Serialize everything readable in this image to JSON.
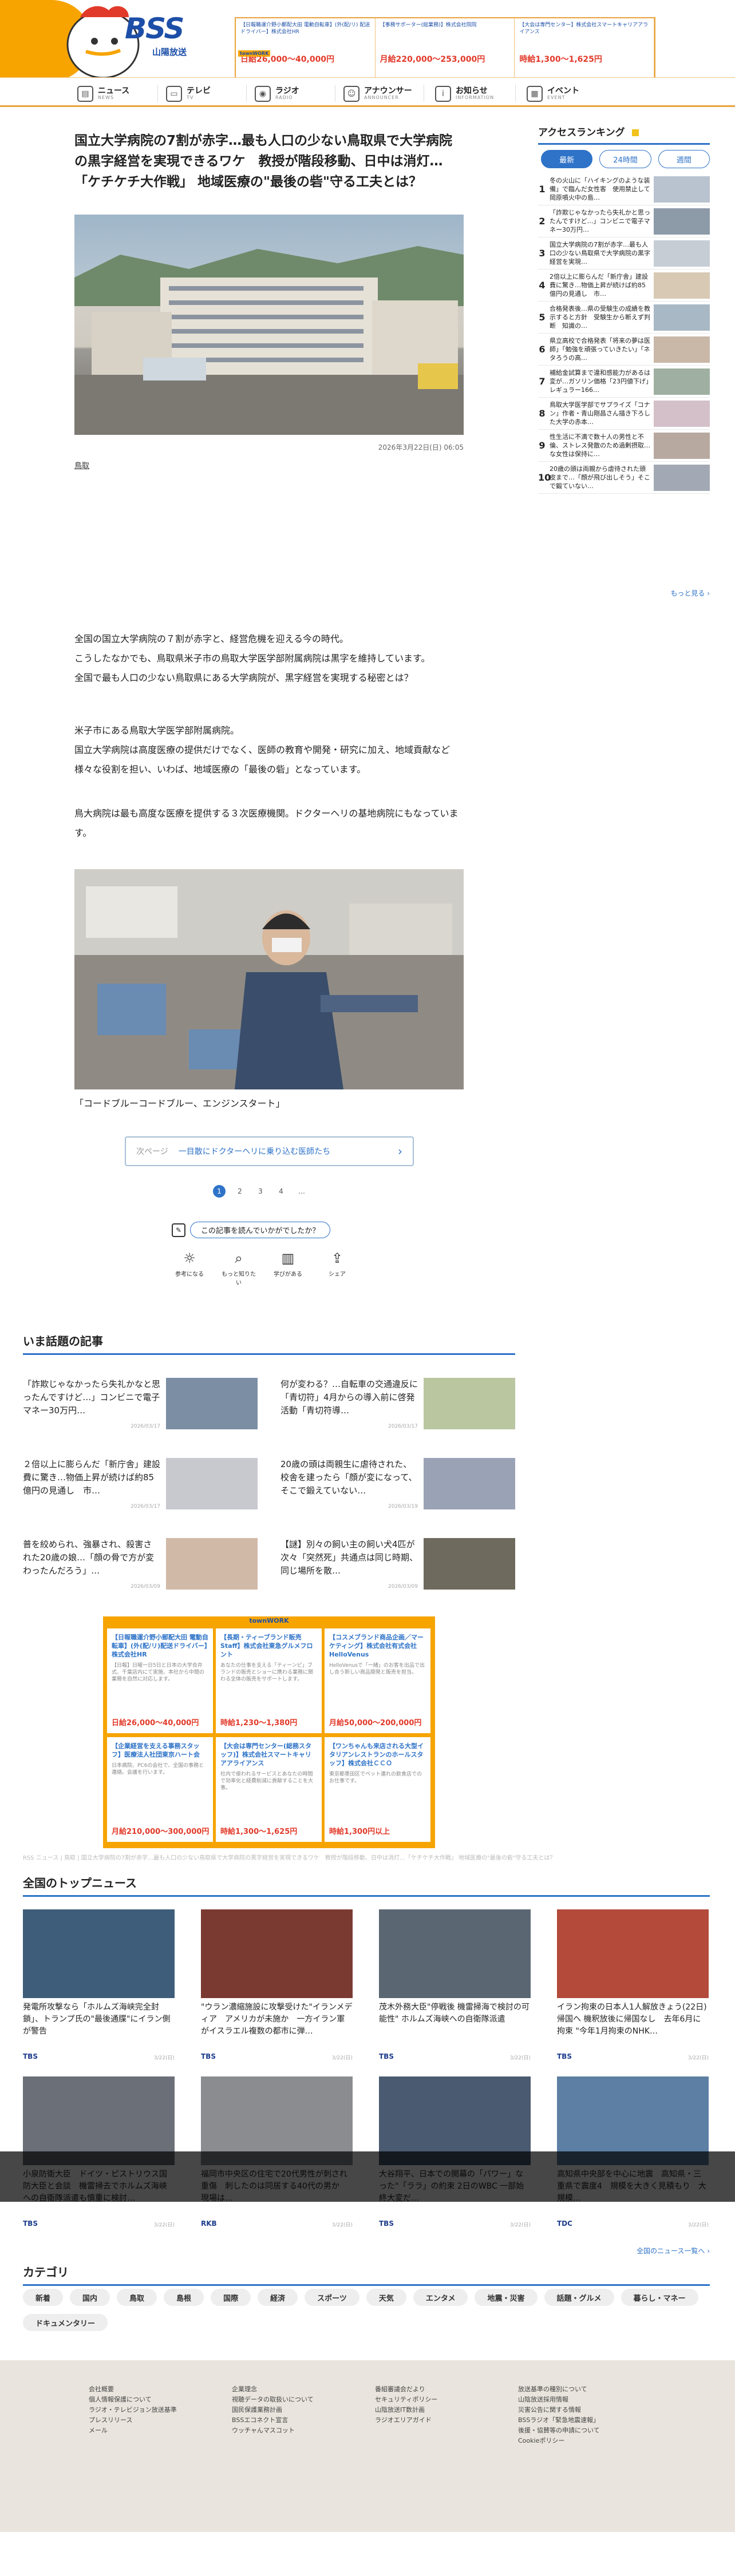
{
  "header": {
    "logo_text": "BSS",
    "logo_sub": "山陽放送",
    "top_ad": {
      "brand": "townWORK",
      "items": [
        {
          "title": "【日報職運介野小郵配大田 電動自転車】(外(配/リ) 配送ドライバー】株式会社HR",
          "salary": "日給26,000〜40,000円"
        },
        {
          "title": "【事務サポーター(総業務)】株式会社院院",
          "salary": "月給220,000〜253,000円"
        },
        {
          "title": "【大会は専門センター】株式会社スマートキャリアアライアンス",
          "salary": "時給1,300〜1,625円"
        }
      ]
    },
    "nav": [
      {
        "label": "ニュース",
        "sub": "NEWS",
        "icon": "news-icon",
        "glyph": "▤"
      },
      {
        "label": "テレビ",
        "sub": "TV",
        "icon": "tv-icon",
        "glyph": "▭"
      },
      {
        "label": "ラジオ",
        "sub": "RADIO",
        "icon": "radio-icon",
        "glyph": "◉"
      },
      {
        "label": "アナウンサー",
        "sub": "ANNOUNCER",
        "icon": "announcer-icon",
        "glyph": "☺"
      },
      {
        "label": "お知らせ",
        "sub": "INFORMATION",
        "icon": "info-icon",
        "glyph": "i"
      },
      {
        "label": "イベント",
        "sub": "EVENT",
        "icon": "event-icon",
        "glyph": "▦"
      }
    ]
  },
  "article": {
    "headline": "国立大学病院の7割が赤字…最も人口の少ない鳥取県で大学病院の黒字経営を実現できるワケ　教授が階段移動、日中は消灯…「ケチケチ大作戦」 地域医療の\"最後の砦\"守る工夫とは？",
    "date": "2026年3月22日(日) 06:05",
    "tag": "鳥取",
    "paragraphs": [
      [
        "全国の国立大学病院の７割が赤字と、経営危機を迎える今の時代。",
        "こうしたなかでも、鳥取県米子市の鳥取大学医学部附属病院は黒字を維持しています。",
        "全国で最も人口の少ない鳥取県にある大学病院が、黒字経営を実現する秘密とは？"
      ],
      [
        "米子市にある鳥取大学医学部附属病院。",
        "国立大学病院は高度医療の提供だけでなく、医師の教育や開発・研究に加え、地域貢献など様々な役割を担い、いわば、地域医療の「最後の砦」となっています。"
      ],
      [
        "鳥大病院は最も高度な医療を提供する３次医療機関。ドクターヘリの基地病院にもなっています。"
      ]
    ],
    "caption": "「コードブルーコードブルー、エンジンスタート」",
    "next_label": "次ページ",
    "next_title": "一目散にドクターヘリに乗り込む医師たち",
    "pages": [
      "1",
      "2",
      "3",
      "4",
      "…"
    ],
    "reaction_question": "この記事を読んでいかがでしたか？",
    "reactions": [
      {
        "label": "参考になる",
        "icon": "bulb-icon",
        "glyph": "☼"
      },
      {
        "label": "もっと知りたい",
        "icon": "magnifier-icon",
        "glyph": "⌕"
      },
      {
        "label": "学びがある",
        "icon": "book-icon",
        "glyph": "▥"
      },
      {
        "label": "シェア",
        "icon": "share-icon",
        "glyph": "⇪"
      }
    ]
  },
  "ranking": {
    "title": "アクセスランキング",
    "tabs": [
      "最新",
      "24時間",
      "週間"
    ],
    "items": [
      {
        "n": "1",
        "text": "冬の火山に「ハイキングのような装備」で臨んだ女性客　使用禁止して岡原噴火中の島…"
      },
      {
        "n": "2",
        "text": "「詐欺じゃなかったら失礼かと思ったんですけど…」コンビニで電子マネー30万円…"
      },
      {
        "n": "3",
        "text": "国立大学病院の7割が赤字…最も人口の少ない鳥取県で大学病院の黒字経営を実現…"
      },
      {
        "n": "4",
        "text": "2倍以上に膨らんだ「新庁舎」建設費に驚き…物価上昇が続けば約85億円の見通し　市…"
      },
      {
        "n": "5",
        "text": "合格発表後…県の受験生の成績を教示すると方針　受験生から断えず判断　知識の…"
      },
      {
        "n": "6",
        "text": "県立高校で合格発表「将来の夢は医師」「勉強を頑張っていきたい」「ネタろうの高…"
      },
      {
        "n": "7",
        "text": "補給金試算まで違和感能力があるは変が…ガソリン価格「23円値下げ」レギュラー166…"
      },
      {
        "n": "8",
        "text": "鳥取大学医学部でサプライズ「コナン」作者・青山剛昌さん描き下ろした大学の赤本…"
      },
      {
        "n": "9",
        "text": "性生活に不満で数十人の男性と不倫、ストレス発散のため過剰摂取…な女性は保持に…"
      },
      {
        "n": "10",
        "text": "20歳の頭は両親から虐待された頭皮まで…「顔が飛び出しそう」そこで鍛ていない…"
      }
    ],
    "more": "もっと見る ›"
  },
  "hot": {
    "title": "いま話題の記事",
    "items": [
      {
        "text": "「詐欺じゃなかったら失礼かなと思ったんですけど…」コンビニで電子マネー30万円…",
        "date": "2026/03/17"
      },
      {
        "text": "何が変わる？…自転車の交通違反に「青切符」4月からの導入前に啓発活動「青切符導…",
        "date": "2026/03/17"
      },
      {
        "text": "２倍以上に膨らんだ「新庁舎」建設費に驚き…物価上昇が続けば約85億円の見通し　市…",
        "date": "2026/03/17"
      },
      {
        "text": "20歳の頭は両親生に虐待された、校舎を建ったら「顔が変になって、そこで鍛えていない…",
        "date": "2026/03/19"
      },
      {
        "text": "普を絞められ、強暴され、殺害された20歳の娘…「顔の骨で方が変わったんだろう」…",
        "date": "2026/03/09"
      },
      {
        "text": "【謎】別々の飼い主の飼い犬4匹が次々「突然死」共通点は同じ時期、同じ場所を散…",
        "date": "2026/03/09"
      }
    ]
  },
  "ad2": {
    "brand": "townWORK",
    "cells": [
      {
        "title": "【日報職運介野小郵配大田 電動自転車】(外(配/リ)配送ドライバー】株式会社HR",
        "body": "【日報】日曜一日5日と日本の大学合弁式、千葉店内にて実施、本社から中間の業務を自然に対応します。",
        "salary": "日給26,000〜40,000円"
      },
      {
        "title": "【長期・ティーブランド販売Staff】株式会社東急グルメフロント",
        "body": "あなたの仕事を支える「ティーンピ」ブランドの販売とショーに携わる業務に関わる全体の販売をサポートします。",
        "salary": "時給1,230〜1,380円"
      },
      {
        "title": "【コスメブランド商品企画／マーケティング】株式会社有式会社HelloVenus",
        "body": "HelloVenusで「一緒」のお客を出品で出し合う新しい商品開発と販売を担当。",
        "salary": "月給50,000〜200,000円"
      },
      {
        "title": "【企業経営を支える事務スタッフ】医療法人社団東京ハート会",
        "body": "日本病院、PC6の会社で、全国の事務と連絡。会議を行います。",
        "salary": "月給210,000〜300,000円"
      },
      {
        "title": "【大会は専門センター(総務スタッフ)】株式会社スマートキャリアアライアンス",
        "body": "社内で使われるサービスとあなたの時間で効率化と経費削減に貢献することを大事。",
        "salary": "時給1,300〜1,625円"
      },
      {
        "title": "【ワンちゃんも来店される大型イタリアンレストランのホールスタッフ】株式会社ＣＣＯ",
        "body": "東京都墨田区でペット連れの飲食店でのお仕事です。",
        "salary": "時給1,300円以上"
      }
    ]
  },
  "breadcrumb": "RSS ニュース | 鳥取 | 国立大学病院の7割が赤字…最も人口の少ない鳥取県で大学病院の黒字経営を実現できるワケ　教授が階段移動、日中は消灯…「ケチケチ大作戦」 地域医療の\"最後の砦\"守る工夫とは？",
  "topnews": {
    "title": "全国のトップニュース",
    "items": [
      {
        "text": "発電所攻撃なら「ホルムズ海峡完全封鎖」、トランプ氏の\"最後通牒\"にイラン側が警告",
        "src": "TBS",
        "date": "3/22(日)"
      },
      {
        "text": "\"ウラン濃縮施設に攻撃受けた\"イランメディア　アメリカが未施か　一方イラン軍がイスラエル複数の都市に弾…",
        "src": "TBS",
        "date": "3/22(日)"
      },
      {
        "text": "茂木外務大臣\"停戦後 機雷掃海で検討の可能性\" ホルムズ海峡への自衛隊派遣",
        "src": "TBS",
        "date": "3/22(日)"
      },
      {
        "text": "イラン拘束の日本人1人解放きょう(22日)帰国へ 機釈放後に帰国なし　去年6月に拘束 \"今年1月拘束のNHK…",
        "src": "TBS",
        "date": "3/22(日)"
      },
      {
        "text": "小泉防衛大臣　ドイツ・ピストリウス国防大臣と会談　機雷掃去でホルムズ海峡への自衛隊派遣も慎重に検討…",
        "src": "TBS",
        "date": "3/22(日)"
      },
      {
        "text": "福岡市中央区の住宅で20代男性が刺され重傷　刺したのは同居する40代の男か　現場は…",
        "src": "RKB",
        "date": "3/22(日)"
      },
      {
        "text": "大谷翔平、日本での開幕の「パワー」なった\"「ララ」の約束 2日のWBC 一部始終大変だ…",
        "src": "TBS",
        "date": "3/22(日)"
      },
      {
        "text": "高知県中央部を中心に地震　高知県・三重県で震度4　規模を大きく見積もり　大規模…",
        "src": "TDC",
        "date": "3/22(日)"
      }
    ],
    "more": "全国のニュース一覧へ ›"
  },
  "categories": {
    "title": "カテゴリ",
    "items": [
      "新着",
      "国内",
      "鳥取",
      "島根",
      "国際",
      "経済",
      "スポーツ",
      "天気",
      "エンタメ",
      "地震・災害",
      "話題・グルメ",
      "暮らし・マネー",
      "ドキュメンタリー"
    ]
  },
  "footer": {
    "cols": [
      [
        "会社概要",
        "個人情報保護について",
        "ラジオ・テレビジョン放送基準",
        "プレスリリース",
        "メール"
      ],
      [
        "企業理念",
        "視聴データの取扱いについて",
        "国民保護業務計画",
        "BSSエコネクト宣言",
        "ウッチャんマスコット"
      ],
      [
        "番組審議会だより",
        "セキュリティポリシー",
        "山陰放送IT数計画",
        "ラジオエリアガイド"
      ],
      [
        "放送基準の種別について",
        "山陰放送採用情報",
        "災害公告に関する情報",
        "BSSラジオ「緊急地震速報」",
        "後援・協賛等の申請について",
        "Cookieポリシー"
      ]
    ]
  }
}
